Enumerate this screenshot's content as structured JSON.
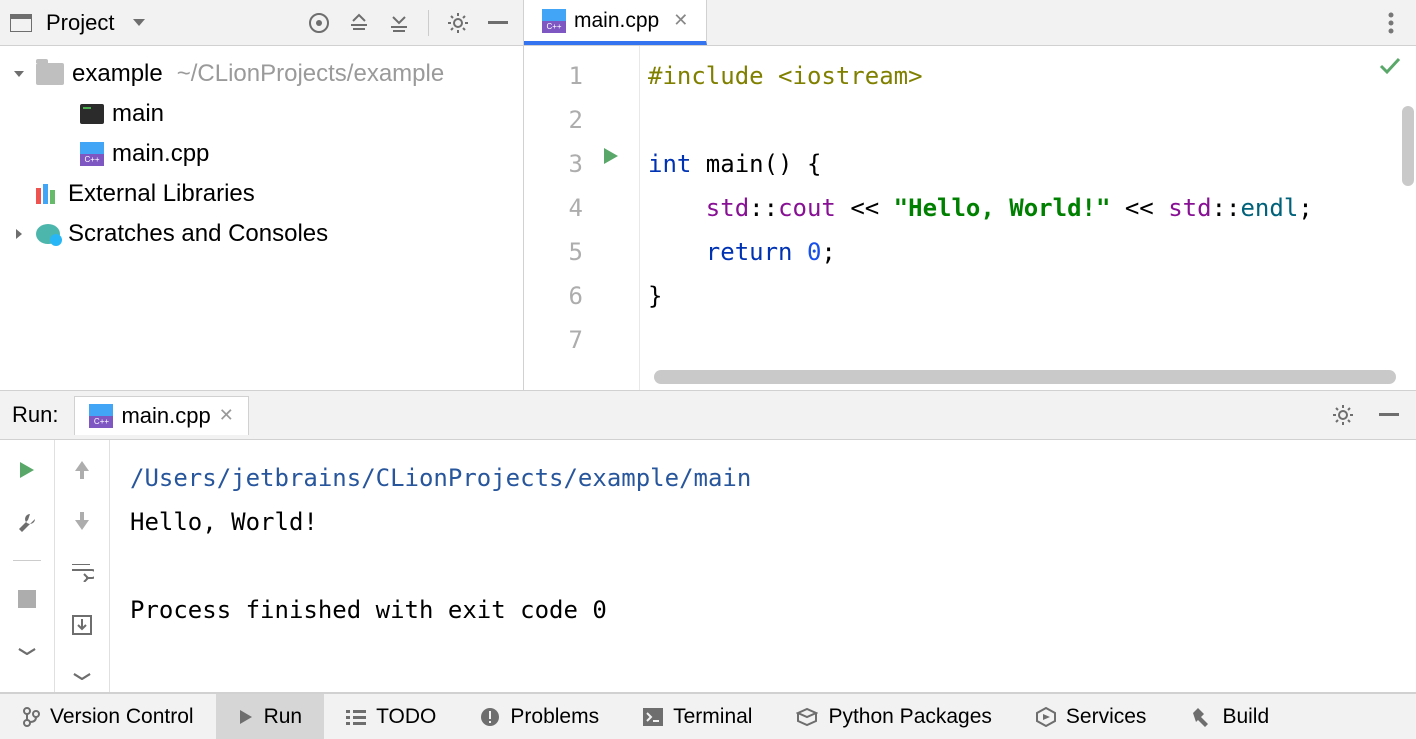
{
  "sidebar": {
    "title": "Project",
    "tree": {
      "root": {
        "name": "example",
        "path": "~/CLionProjects/example"
      },
      "files": [
        {
          "name": "main"
        },
        {
          "name": "main.cpp"
        }
      ],
      "external": "External Libraries",
      "scratches": "Scratches and Consoles"
    }
  },
  "editor": {
    "tab": {
      "name": "main.cpp"
    },
    "gutter": [
      "1",
      "2",
      "3",
      "4",
      "5",
      "6",
      "7"
    ],
    "code": {
      "l1_a": "#include ",
      "l1_b": "<iostream>",
      "l3_a": "int ",
      "l3_b": "main",
      "l3_c": "() {",
      "l4_a": "    std",
      "l4_b": "::",
      "l4_c": "cout ",
      "l4_d": "<< ",
      "l4_e": "\"Hello, World!\" ",
      "l4_f": "<< ",
      "l4_g": "std",
      "l4_h": "::",
      "l4_i": "endl",
      "l4_j": ";",
      "l5_a": "    return ",
      "l5_b": "0",
      "l5_c": ";",
      "l6": "}"
    }
  },
  "run_panel": {
    "label": "Run:",
    "tab": "main.cpp",
    "console": {
      "path": "/Users/jetbrains/CLionProjects/example/main",
      "out": "Hello, World!",
      "exit": "Process finished with exit code 0"
    }
  },
  "statusbar": {
    "items": [
      "Version Control",
      "Run",
      "TODO",
      "Problems",
      "Terminal",
      "Python Packages",
      "Services",
      "Build"
    ]
  }
}
